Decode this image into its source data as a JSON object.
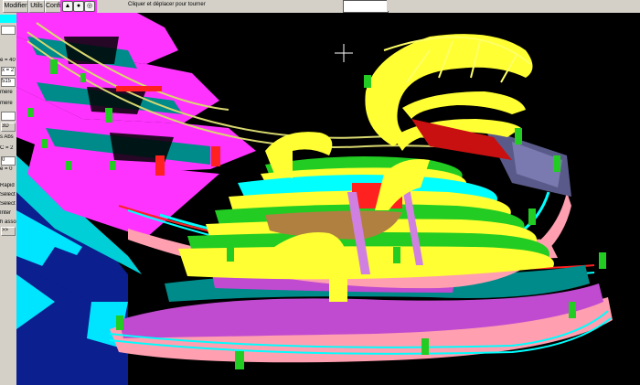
{
  "menu": {
    "modifier": "Modifier",
    "utils": "Utils",
    "config": "Config"
  },
  "toolbar": {
    "btn1": "▲",
    "btn2": "●",
    "btn3": "◎"
  },
  "status_text": "Cliquer et déplacer pour tourner",
  "panel": {
    "items": [
      "",
      "",
      "e = 40",
      "x = 2",
      "515",
      "mère",
      "mère",
      "",
      "3D",
      "s Abs",
      "C = 2",
      "0",
      "e = 0",
      "Rapid",
      "Sélect",
      "Sélect",
      "Inter",
      "h asso",
      ">>"
    ]
  },
  "colors": {
    "magenta": "#ff33ff",
    "cyan": "#00ffff",
    "teal": "#008b8b",
    "yellow": "#ffff33",
    "green": "#22cc22",
    "red": "#ff2020",
    "blue": "#0b1f8f",
    "pink": "#ff9fb0",
    "purple": "#c04ad0"
  },
  "icons": [
    "crosshair-icon"
  ]
}
